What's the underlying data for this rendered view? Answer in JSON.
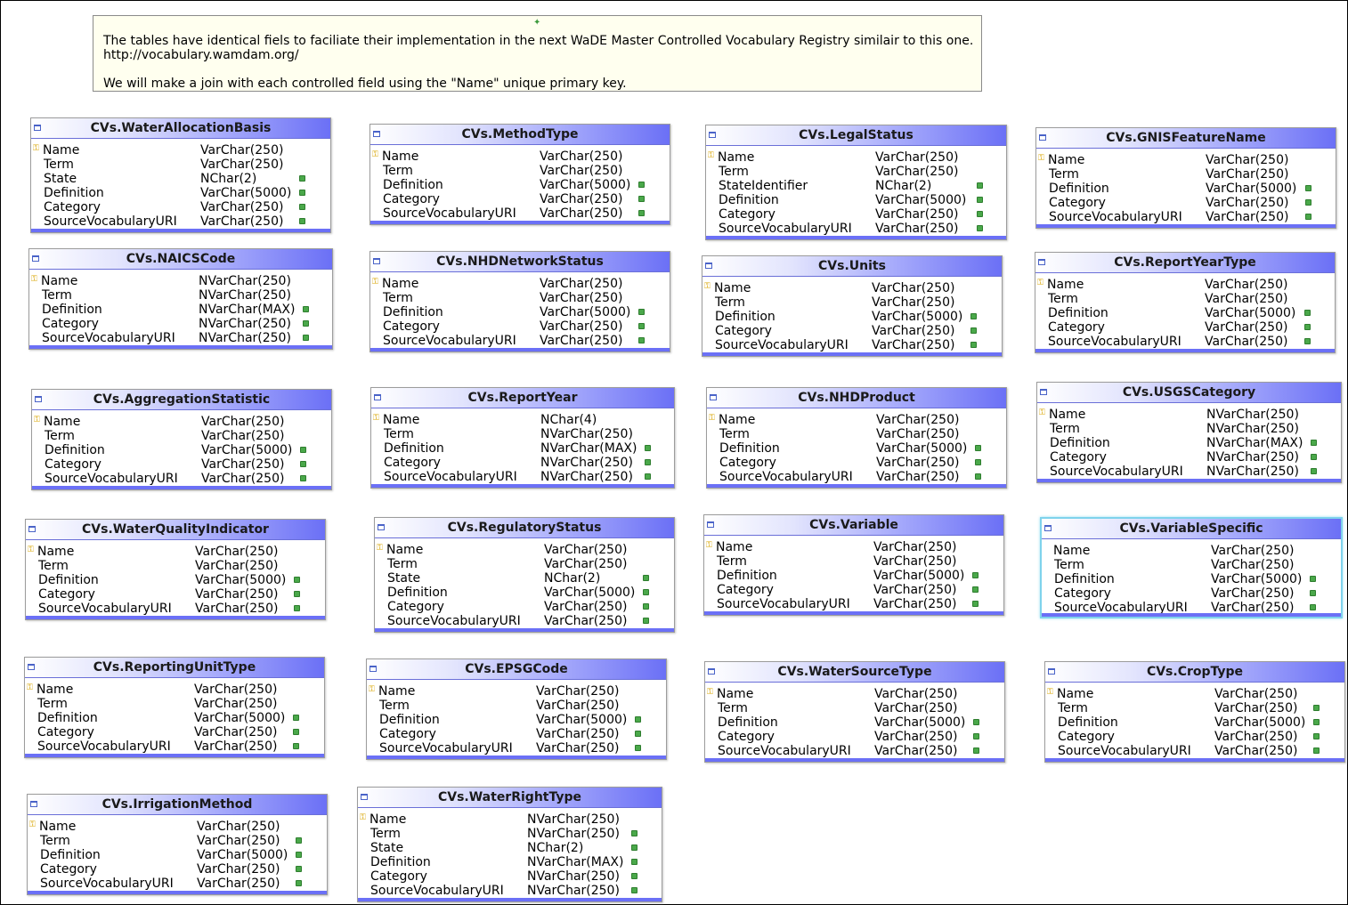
{
  "note": {
    "lines": [
      "The tables have identical fiels to faciliate their implementation in the next WaDE Master Controlled Vocabulary Registry similair to this one.",
      "http://vocabulary.wamdam.org/",
      "We will make a join with each controlled field using the \"Name\" unique primary key."
    ]
  },
  "colors": {
    "header_gradient_end": "#6b70f6",
    "primary_key_icon": "#d8a400",
    "nullable_icon": "#4aa84a",
    "selected_border": "#7fd3ec"
  },
  "icons": {
    "table": "table-icon",
    "primary_key": "key-icon",
    "nullable": "nullable-icon",
    "note_pin": "pin-icon"
  },
  "tables": [
    {
      "title": "CVs.WaterAllocationBasis",
      "columns": [
        {
          "name": "Name",
          "type": "VarChar(250)",
          "pk": true,
          "nullable": false
        },
        {
          "name": "Term",
          "type": "VarChar(250)",
          "pk": false,
          "nullable": false
        },
        {
          "name": "State",
          "type": "NChar(2)",
          "pk": false,
          "nullable": true
        },
        {
          "name": "Definition",
          "type": "VarChar(5000)",
          "pk": false,
          "nullable": true
        },
        {
          "name": "Category",
          "type": "VarChar(250)",
          "pk": false,
          "nullable": true
        },
        {
          "name": "SourceVocabularyURI",
          "type": "VarChar(250)",
          "pk": false,
          "nullable": true
        }
      ]
    },
    {
      "title": "CVs.MethodType",
      "columns": [
        {
          "name": "Name",
          "type": "VarChar(250)",
          "pk": true,
          "nullable": false
        },
        {
          "name": "Term",
          "type": "VarChar(250)",
          "pk": false,
          "nullable": false
        },
        {
          "name": "Definition",
          "type": "VarChar(5000)",
          "pk": false,
          "nullable": true
        },
        {
          "name": "Category",
          "type": "VarChar(250)",
          "pk": false,
          "nullable": true
        },
        {
          "name": "SourceVocabularyURI",
          "type": "VarChar(250)",
          "pk": false,
          "nullable": true
        }
      ]
    },
    {
      "title": "CVs.LegalStatus",
      "columns": [
        {
          "name": "Name",
          "type": "VarChar(250)",
          "pk": true,
          "nullable": false
        },
        {
          "name": "Term",
          "type": "VarChar(250)",
          "pk": false,
          "nullable": false
        },
        {
          "name": "StateIdentifier",
          "type": "NChar(2)",
          "pk": false,
          "nullable": true
        },
        {
          "name": "Definition",
          "type": "VarChar(5000)",
          "pk": false,
          "nullable": true
        },
        {
          "name": "Category",
          "type": "VarChar(250)",
          "pk": false,
          "nullable": true
        },
        {
          "name": "SourceVocabularyURI",
          "type": "VarChar(250)",
          "pk": false,
          "nullable": true
        }
      ]
    },
    {
      "title": "CVs.GNISFeatureName",
      "columns": [
        {
          "name": "Name",
          "type": "VarChar(250)",
          "pk": true,
          "nullable": false
        },
        {
          "name": "Term",
          "type": "VarChar(250)",
          "pk": false,
          "nullable": false
        },
        {
          "name": "Definition",
          "type": "VarChar(5000)",
          "pk": false,
          "nullable": true
        },
        {
          "name": "Category",
          "type": "VarChar(250)",
          "pk": false,
          "nullable": true
        },
        {
          "name": "SourceVocabularyURI",
          "type": "VarChar(250)",
          "pk": false,
          "nullable": true
        }
      ]
    },
    {
      "title": "CVs.NAICSCode",
      "columns": [
        {
          "name": "Name",
          "type": "NVarChar(250)",
          "pk": true,
          "nullable": false
        },
        {
          "name": "Term",
          "type": "NVarChar(250)",
          "pk": false,
          "nullable": false
        },
        {
          "name": "Definition",
          "type": "NVarChar(MAX)",
          "pk": false,
          "nullable": true
        },
        {
          "name": "Category",
          "type": "NVarChar(250)",
          "pk": false,
          "nullable": true
        },
        {
          "name": "SourceVocabularyURI",
          "type": "NVarChar(250)",
          "pk": false,
          "nullable": true
        }
      ]
    },
    {
      "title": "CVs.NHDNetworkStatus",
      "columns": [
        {
          "name": "Name",
          "type": "VarChar(250)",
          "pk": true,
          "nullable": false
        },
        {
          "name": "Term",
          "type": "VarChar(250)",
          "pk": false,
          "nullable": false
        },
        {
          "name": "Definition",
          "type": "VarChar(5000)",
          "pk": false,
          "nullable": true
        },
        {
          "name": "Category",
          "type": "VarChar(250)",
          "pk": false,
          "nullable": true
        },
        {
          "name": "SourceVocabularyURI",
          "type": "VarChar(250)",
          "pk": false,
          "nullable": true
        }
      ]
    },
    {
      "title": "CVs.Units",
      "columns": [
        {
          "name": "Name",
          "type": "VarChar(250)",
          "pk": true,
          "nullable": false
        },
        {
          "name": "Term",
          "type": "VarChar(250)",
          "pk": false,
          "nullable": false
        },
        {
          "name": "Definition",
          "type": "VarChar(5000)",
          "pk": false,
          "nullable": true
        },
        {
          "name": "Category",
          "type": "VarChar(250)",
          "pk": false,
          "nullable": true
        },
        {
          "name": "SourceVocabularyURI",
          "type": "VarChar(250)",
          "pk": false,
          "nullable": true
        }
      ]
    },
    {
      "title": "CVs.ReportYearType",
      "columns": [
        {
          "name": "Name",
          "type": "VarChar(250)",
          "pk": true,
          "nullable": false
        },
        {
          "name": "Term",
          "type": "VarChar(250)",
          "pk": false,
          "nullable": false
        },
        {
          "name": "Definition",
          "type": "VarChar(5000)",
          "pk": false,
          "nullable": true
        },
        {
          "name": "Category",
          "type": "VarChar(250)",
          "pk": false,
          "nullable": true
        },
        {
          "name": "SourceVocabularyURI",
          "type": "VarChar(250)",
          "pk": false,
          "nullable": true
        }
      ]
    },
    {
      "title": "CVs.AggregationStatistic",
      "columns": [
        {
          "name": "Name",
          "type": "VarChar(250)",
          "pk": true,
          "nullable": false
        },
        {
          "name": "Term",
          "type": "VarChar(250)",
          "pk": false,
          "nullable": false
        },
        {
          "name": "Definition",
          "type": "VarChar(5000)",
          "pk": false,
          "nullable": true
        },
        {
          "name": "Category",
          "type": "VarChar(250)",
          "pk": false,
          "nullable": true
        },
        {
          "name": "SourceVocabularyURI",
          "type": "VarChar(250)",
          "pk": false,
          "nullable": true
        }
      ]
    },
    {
      "title": "CVs.ReportYear",
      "columns": [
        {
          "name": "Name",
          "type": "NChar(4)",
          "pk": true,
          "nullable": false
        },
        {
          "name": "Term",
          "type": "NVarChar(250)",
          "pk": false,
          "nullable": false
        },
        {
          "name": "Definition",
          "type": "NVarChar(MAX)",
          "pk": false,
          "nullable": true
        },
        {
          "name": "Category",
          "type": "NVarChar(250)",
          "pk": false,
          "nullable": true
        },
        {
          "name": "SourceVocabularyURI",
          "type": "NVarChar(250)",
          "pk": false,
          "nullable": true
        }
      ]
    },
    {
      "title": "CVs.NHDProduct",
      "columns": [
        {
          "name": "Name",
          "type": "VarChar(250)",
          "pk": true,
          "nullable": false
        },
        {
          "name": "Term",
          "type": "VarChar(250)",
          "pk": false,
          "nullable": false
        },
        {
          "name": "Definition",
          "type": "VarChar(5000)",
          "pk": false,
          "nullable": true
        },
        {
          "name": "Category",
          "type": "VarChar(250)",
          "pk": false,
          "nullable": true
        },
        {
          "name": "SourceVocabularyURI",
          "type": "VarChar(250)",
          "pk": false,
          "nullable": true
        }
      ]
    },
    {
      "title": "CVs.USGSCategory",
      "columns": [
        {
          "name": "Name",
          "type": "NVarChar(250)",
          "pk": true,
          "nullable": false
        },
        {
          "name": "Term",
          "type": "NVarChar(250)",
          "pk": false,
          "nullable": false
        },
        {
          "name": "Definition",
          "type": "NVarChar(MAX)",
          "pk": false,
          "nullable": true
        },
        {
          "name": "Category",
          "type": "NVarChar(250)",
          "pk": false,
          "nullable": true
        },
        {
          "name": "SourceVocabularyURI",
          "type": "NVarChar(250)",
          "pk": false,
          "nullable": true
        }
      ]
    },
    {
      "title": "CVs.WaterQualityIndicator",
      "columns": [
        {
          "name": "Name",
          "type": "VarChar(250)",
          "pk": true,
          "nullable": false
        },
        {
          "name": "Term",
          "type": "VarChar(250)",
          "pk": false,
          "nullable": false
        },
        {
          "name": "Definition",
          "type": "VarChar(5000)",
          "pk": false,
          "nullable": true
        },
        {
          "name": "Category",
          "type": "VarChar(250)",
          "pk": false,
          "nullable": true
        },
        {
          "name": "SourceVocabularyURI",
          "type": "VarChar(250)",
          "pk": false,
          "nullable": true
        }
      ]
    },
    {
      "title": "CVs.RegulatoryStatus",
      "columns": [
        {
          "name": "Name",
          "type": "VarChar(250)",
          "pk": true,
          "nullable": false
        },
        {
          "name": "Term",
          "type": "VarChar(250)",
          "pk": false,
          "nullable": false
        },
        {
          "name": "State",
          "type": "NChar(2)",
          "pk": false,
          "nullable": true
        },
        {
          "name": "Definition",
          "type": "VarChar(5000)",
          "pk": false,
          "nullable": true
        },
        {
          "name": "Category",
          "type": "VarChar(250)",
          "pk": false,
          "nullable": true
        },
        {
          "name": "SourceVocabularyURI",
          "type": "VarChar(250)",
          "pk": false,
          "nullable": true
        }
      ]
    },
    {
      "title": "CVs.Variable",
      "columns": [
        {
          "name": "Name",
          "type": "VarChar(250)",
          "pk": true,
          "nullable": false
        },
        {
          "name": "Term",
          "type": "VarChar(250)",
          "pk": false,
          "nullable": false
        },
        {
          "name": "Definition",
          "type": "VarChar(5000)",
          "pk": false,
          "nullable": true
        },
        {
          "name": "Category",
          "type": "VarChar(250)",
          "pk": false,
          "nullable": true
        },
        {
          "name": "SourceVocabularyURI",
          "type": "VarChar(250)",
          "pk": false,
          "nullable": true
        }
      ]
    },
    {
      "title": "CVs.VariableSpecific",
      "selected": true,
      "columns": [
        {
          "name": "Name",
          "type": "VarChar(250)",
          "pk": false,
          "nullable": false
        },
        {
          "name": "Term",
          "type": "VarChar(250)",
          "pk": false,
          "nullable": false
        },
        {
          "name": "Definition",
          "type": "VarChar(5000)",
          "pk": false,
          "nullable": true
        },
        {
          "name": "Category",
          "type": "VarChar(250)",
          "pk": false,
          "nullable": true
        },
        {
          "name": "SourceVocabularyURI",
          "type": "VarChar(250)",
          "pk": false,
          "nullable": true
        }
      ]
    },
    {
      "title": "CVs.ReportingUnitType",
      "columns": [
        {
          "name": "Name",
          "type": "VarChar(250)",
          "pk": true,
          "nullable": false
        },
        {
          "name": "Term",
          "type": "VarChar(250)",
          "pk": false,
          "nullable": false
        },
        {
          "name": "Definition",
          "type": "VarChar(5000)",
          "pk": false,
          "nullable": true
        },
        {
          "name": "Category",
          "type": "VarChar(250)",
          "pk": false,
          "nullable": true
        },
        {
          "name": "SourceVocabularyURI",
          "type": "VarChar(250)",
          "pk": false,
          "nullable": true
        }
      ]
    },
    {
      "title": "CVs.EPSGCode",
      "columns": [
        {
          "name": "Name",
          "type": "VarChar(250)",
          "pk": true,
          "nullable": false
        },
        {
          "name": "Term",
          "type": "VarChar(250)",
          "pk": false,
          "nullable": false
        },
        {
          "name": "Definition",
          "type": "VarChar(5000)",
          "pk": false,
          "nullable": true
        },
        {
          "name": "Category",
          "type": "VarChar(250)",
          "pk": false,
          "nullable": true
        },
        {
          "name": "SourceVocabularyURI",
          "type": "VarChar(250)",
          "pk": false,
          "nullable": true
        }
      ]
    },
    {
      "title": "CVs.WaterSourceType",
      "columns": [
        {
          "name": "Name",
          "type": "VarChar(250)",
          "pk": true,
          "nullable": false
        },
        {
          "name": "Term",
          "type": "VarChar(250)",
          "pk": false,
          "nullable": false
        },
        {
          "name": "Definition",
          "type": "VarChar(5000)",
          "pk": false,
          "nullable": true
        },
        {
          "name": "Category",
          "type": "VarChar(250)",
          "pk": false,
          "nullable": true
        },
        {
          "name": "SourceVocabularyURI",
          "type": "VarChar(250)",
          "pk": false,
          "nullable": true
        }
      ]
    },
    {
      "title": "CVs.CropType",
      "columns": [
        {
          "name": "Name",
          "type": "VarChar(250)",
          "pk": true,
          "nullable": false
        },
        {
          "name": "Term",
          "type": "VarChar(250)",
          "pk": false,
          "nullable": true
        },
        {
          "name": "Definition",
          "type": "VarChar(5000)",
          "pk": false,
          "nullable": true
        },
        {
          "name": "Category",
          "type": "VarChar(250)",
          "pk": false,
          "nullable": true
        },
        {
          "name": "SourceVocabularyURI",
          "type": "VarChar(250)",
          "pk": false,
          "nullable": true
        }
      ]
    },
    {
      "title": "CVs.IrrigationMethod",
      "columns": [
        {
          "name": "Name",
          "type": "VarChar(250)",
          "pk": true,
          "nullable": false
        },
        {
          "name": "Term",
          "type": "VarChar(250)",
          "pk": false,
          "nullable": true
        },
        {
          "name": "Definition",
          "type": "VarChar(5000)",
          "pk": false,
          "nullable": true
        },
        {
          "name": "Category",
          "type": "VarChar(250)",
          "pk": false,
          "nullable": true
        },
        {
          "name": "SourceVocabularyURI",
          "type": "VarChar(250)",
          "pk": false,
          "nullable": true
        }
      ]
    },
    {
      "title": "CVs.WaterRightType",
      "columns": [
        {
          "name": "Name",
          "type": "NVarChar(250)",
          "pk": true,
          "nullable": false
        },
        {
          "name": "Term",
          "type": "NVarChar(250)",
          "pk": false,
          "nullable": true
        },
        {
          "name": "State",
          "type": "NChar(2)",
          "pk": false,
          "nullable": true
        },
        {
          "name": "Definition",
          "type": "NVarChar(MAX)",
          "pk": false,
          "nullable": true
        },
        {
          "name": "Category",
          "type": "NVarChar(250)",
          "pk": false,
          "nullable": true
        },
        {
          "name": "SourceVocabularyURI",
          "type": "NVarChar(250)",
          "pk": false,
          "nullable": true
        }
      ]
    }
  ]
}
